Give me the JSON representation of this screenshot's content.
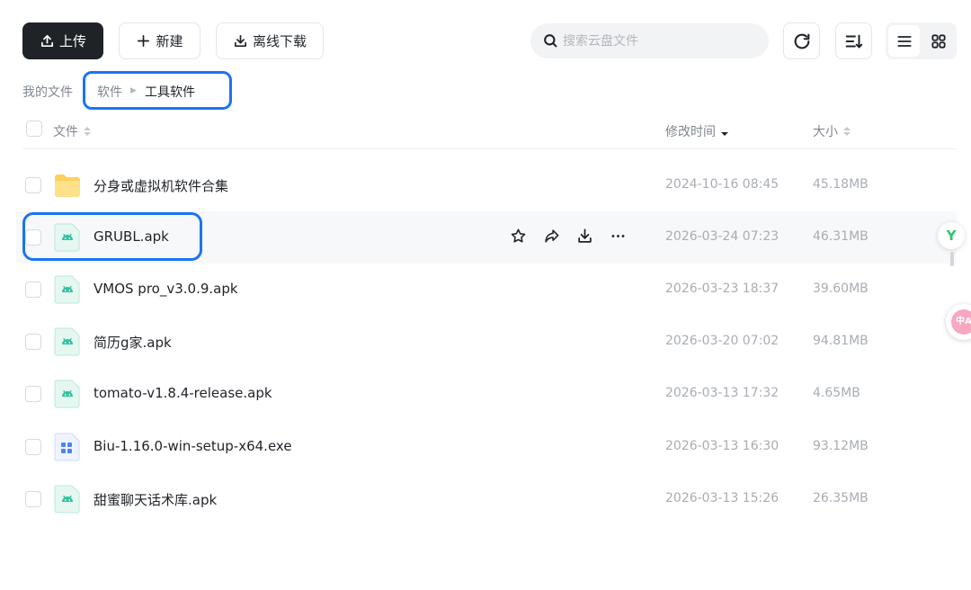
{
  "toolbar": {
    "upload_label": "上传",
    "new_label": "新建",
    "offline_label": "离线下载"
  },
  "search": {
    "placeholder": "搜索云盘文件",
    "icon": "search-icon"
  },
  "toolbar_right": {
    "refresh_icon": "refresh-icon",
    "sort_icon": "sort-icon",
    "list_view_icon": "list-view-icon",
    "grid_view_icon": "grid-view-icon",
    "active_view": "list"
  },
  "breadcrumb": {
    "root": "我的文件",
    "items": [
      "软件",
      "工具软件"
    ],
    "separator": "▶"
  },
  "table": {
    "headers": {
      "name": "文件",
      "modified": "修改时间",
      "size": "大小"
    },
    "sort": {
      "column": "modified",
      "direction": "desc"
    },
    "rows": [
      {
        "name": "分身或虚拟机软件合集",
        "modified": "2024-10-16 08:45",
        "size": "45.18MB",
        "icon": "folder-icon"
      },
      {
        "name": "GRUBL.apk",
        "modified": "2026-03-24 07:23",
        "size": "46.31MB",
        "icon": "android-file-icon",
        "hovered": true
      },
      {
        "name": "VMOS pro_v3.0.9.apk",
        "modified": "2026-03-23 18:37",
        "size": "39.60MB",
        "icon": "android-file-icon"
      },
      {
        "name": "简历g家.apk",
        "modified": "2026-03-20 07:02",
        "size": "94.81MB",
        "icon": "android-file-icon"
      },
      {
        "name": "tomato-v1.8.4-release.apk",
        "modified": "2026-03-13 17:32",
        "size": "4.65MB",
        "icon": "android-file-icon"
      },
      {
        "name": "Biu-1.16.0-win-setup-x64.exe",
        "modified": "2026-03-13 16:30",
        "size": "93.12MB",
        "icon": "exe-file-icon"
      },
      {
        "name": "甜蜜聊天话术库.apk",
        "modified": "2026-03-13 15:26",
        "size": "26.35MB",
        "icon": "android-file-icon"
      }
    ]
  },
  "row_actions": [
    "star-icon",
    "share-icon",
    "download-icon",
    "more-icon"
  ],
  "side_widgets": {
    "y_badge": "Y",
    "translate_badge": "中A"
  },
  "colors": {
    "primary_dark": "#1f2328",
    "highlight_outline": "#1b74f0",
    "android_green": "#2fc2a0",
    "folder_yellow": "#fcd15c"
  }
}
